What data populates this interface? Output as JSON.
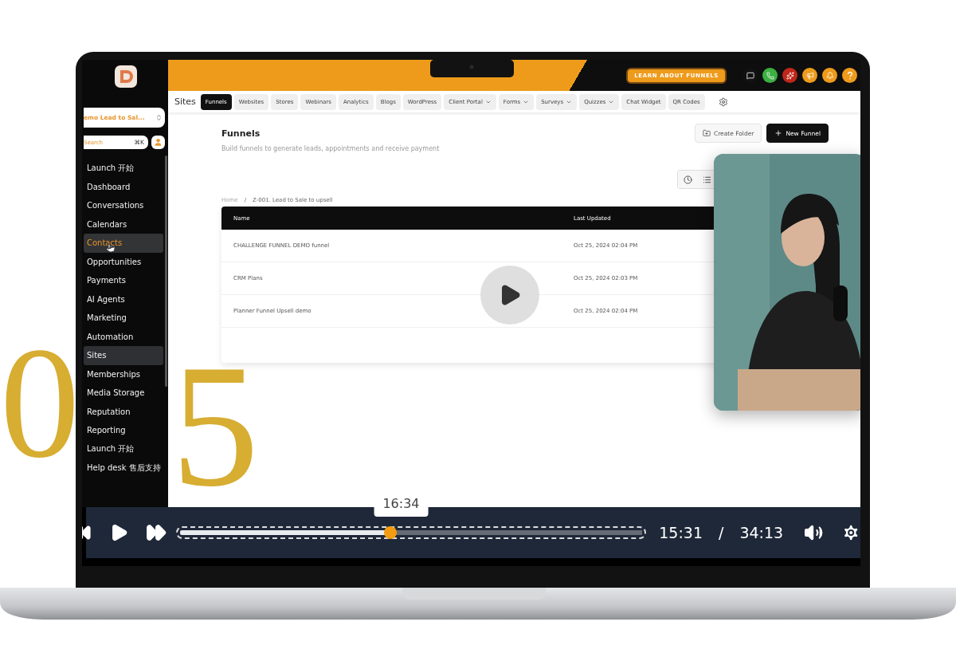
{
  "sidebar": {
    "account": "emo Lead to Sal...",
    "search": {
      "placeholder": "Search",
      "shortcut": "⌘K"
    },
    "items": [
      {
        "label": "Launch 开始",
        "selected": false,
        "hovered": false
      },
      {
        "label": "Dashboard",
        "selected": false,
        "hovered": false
      },
      {
        "label": "Conversations",
        "selected": false,
        "hovered": false
      },
      {
        "label": "Calendars",
        "selected": false,
        "hovered": false
      },
      {
        "label": "Contacts",
        "selected": false,
        "hovered": true
      },
      {
        "label": "Opportunities",
        "selected": false,
        "hovered": false
      },
      {
        "label": "Payments",
        "selected": false,
        "hovered": false
      },
      {
        "label": "AI Agents",
        "selected": false,
        "hovered": false
      },
      {
        "label": "Marketing",
        "selected": false,
        "hovered": false
      },
      {
        "label": "Automation",
        "selected": false,
        "hovered": false
      },
      {
        "label": "Sites",
        "selected": true,
        "hovered": false
      },
      {
        "label": "Memberships",
        "selected": false,
        "hovered": false
      },
      {
        "label": "Media Storage",
        "selected": false,
        "hovered": false
      },
      {
        "label": "Reputation",
        "selected": false,
        "hovered": false
      },
      {
        "label": "Reporting",
        "selected": false,
        "hovered": false
      },
      {
        "label": "Launch 开始",
        "selected": false,
        "hovered": false
      },
      {
        "label": "Help desk 售后支持",
        "selected": false,
        "hovered": false
      }
    ]
  },
  "banner": {
    "button": "LEARN ABOUT FUNNELS"
  },
  "nav": {
    "section": "Sites",
    "tabs": [
      {
        "label": "Funnels",
        "selected": true,
        "dropdown": false
      },
      {
        "label": "Websites",
        "selected": false,
        "dropdown": false
      },
      {
        "label": "Stores",
        "selected": false,
        "dropdown": false
      },
      {
        "label": "Webinars",
        "selected": false,
        "dropdown": false
      },
      {
        "label": "Analytics",
        "selected": false,
        "dropdown": false
      },
      {
        "label": "Blogs",
        "selected": false,
        "dropdown": false
      },
      {
        "label": "WordPress",
        "selected": false,
        "dropdown": false
      },
      {
        "label": "Client Portal",
        "selected": false,
        "dropdown": true
      },
      {
        "label": "Forms",
        "selected": false,
        "dropdown": true
      },
      {
        "label": "Surveys",
        "selected": false,
        "dropdown": true
      },
      {
        "label": "Quizzes",
        "selected": false,
        "dropdown": true
      },
      {
        "label": "Chat Widget",
        "selected": false,
        "dropdown": false
      },
      {
        "label": "QR Codes",
        "selected": false,
        "dropdown": false
      }
    ]
  },
  "page": {
    "title": "Funnels",
    "subtitle": "Build funnels to generate leads, appointments and receive payment",
    "buttons": [
      {
        "label": "Create Folder",
        "kind": "secondary"
      },
      {
        "label": "New Funnel",
        "kind": "primary"
      }
    ],
    "breadcrumb": [
      "Home",
      "/",
      "Z-001. Lead to Sale to upsell"
    ]
  },
  "table": {
    "columns": [
      "Name",
      "Last Updated"
    ],
    "rows": [
      [
        "CHALLENGE FUNNEL DEMO funnel",
        "Oct 25, 2024 02:04 PM"
      ],
      [
        "CRM Plans",
        "Oct 25, 2024 02:03 PM"
      ],
      [
        "Planner Funnel Upsell demo",
        "Oct 25, 2024 02:04 PM"
      ]
    ]
  },
  "player": {
    "tooltip": "16:34",
    "level": 0.455,
    "current": "15:31",
    "separator": "/",
    "total": "34:13"
  },
  "overlay_numerals": [
    "0",
    "5"
  ]
}
